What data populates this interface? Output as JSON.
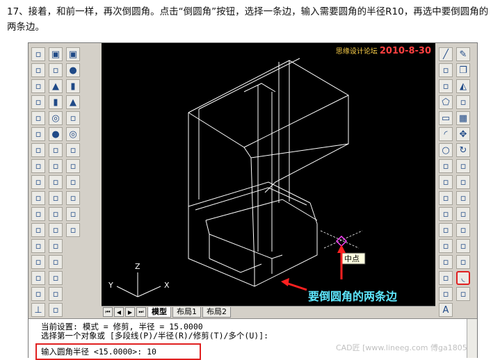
{
  "instruction": "17、接着，和前一样，再次倒圆角。点击“倒圆角”按钮，选择一条边，输入需要圆角的半径R10，再选中要倒圆角的两条边。",
  "watermark": {
    "site": "思缘设计论坛",
    "date": "2010-8-30"
  },
  "viewport": {
    "axis_x": "X",
    "axis_y": "Y",
    "axis_z": "Z",
    "midpoint_label": "中点",
    "annotation": "要倒圆角的两条边"
  },
  "layout_tabs": [
    {
      "label": "模型",
      "active": true
    },
    {
      "label": "布局1",
      "active": false
    },
    {
      "label": "布局2",
      "active": false
    }
  ],
  "command": {
    "line1": "当前设置: 模式 = 修剪, 半径 = 15.0000",
    "line2": "选择第一个对象或 [多段线(P)/半径(R)/修剪(T)/多个(U)]:",
    "line3": "输入圆角半径 <15.0000>: 10",
    "footer": "CAD匠 [www.lineeg.com 傅ga1805]"
  },
  "colors": {
    "accent_red": "#e02020",
    "annotation_cyan": "#5ee8ff",
    "model_line": "#ffffff",
    "canvas_bg": "#000000"
  },
  "toolbars": {
    "col1": [
      "dim-linear-icon",
      "dim-aligned-icon",
      "dim-ordinate-icon",
      "dim-radius-icon",
      "dim-diameter-icon",
      "dim-angular-icon",
      "quick-dim-icon",
      "dim-baseline-icon",
      "dim-continue-icon",
      "quick-leader-icon",
      "tolerance-icon",
      "center-mark-icon",
      "dim-edit-icon",
      "dim-text-edit-icon",
      "dim-update-icon",
      "dim-style-icon",
      "ucs-icon"
    ],
    "col2": [
      "box-icon",
      "wedge-icon",
      "cone-icon",
      "cylinder-icon",
      "torus-icon",
      "sphere-icon",
      "extrude-icon",
      "revolve-icon",
      "slice-icon",
      "section-icon",
      "interfere-icon",
      "setup-drawing-icon",
      "setup-view-icon",
      "setup-profile-icon",
      "union-icon",
      "subtract-icon",
      "intersect-icon"
    ],
    "col3": [
      "cube-icon",
      "sphere-icon",
      "cylinder-icon",
      "cone-icon",
      "wedge-icon",
      "torus-icon",
      "extrude-icon",
      "revolve-icon",
      "slice-icon",
      "section-icon",
      "interfere-icon",
      "render-icon"
    ],
    "right1": [
      "line-icon",
      "construction-line-icon",
      "polyline-icon",
      "polygon-icon",
      "rectangle-icon",
      "arc-icon",
      "circle-icon",
      "revcloud-icon",
      "spline-icon",
      "ellipse-icon",
      "ellipse-arc-icon",
      "insert-block-icon",
      "make-block-icon",
      "point-icon",
      "hatch-icon",
      "region-icon",
      "text-icon"
    ],
    "right2": [
      "erase-icon",
      "copy-icon",
      "mirror-icon",
      "offset-icon",
      "array-icon",
      "move-icon",
      "rotate-icon",
      "scale-icon",
      "stretch-icon",
      "trim-icon",
      "extend-icon",
      "break-icon",
      "join-icon",
      "chamfer-icon",
      "fillet-icon",
      "explode-icon"
    ]
  }
}
